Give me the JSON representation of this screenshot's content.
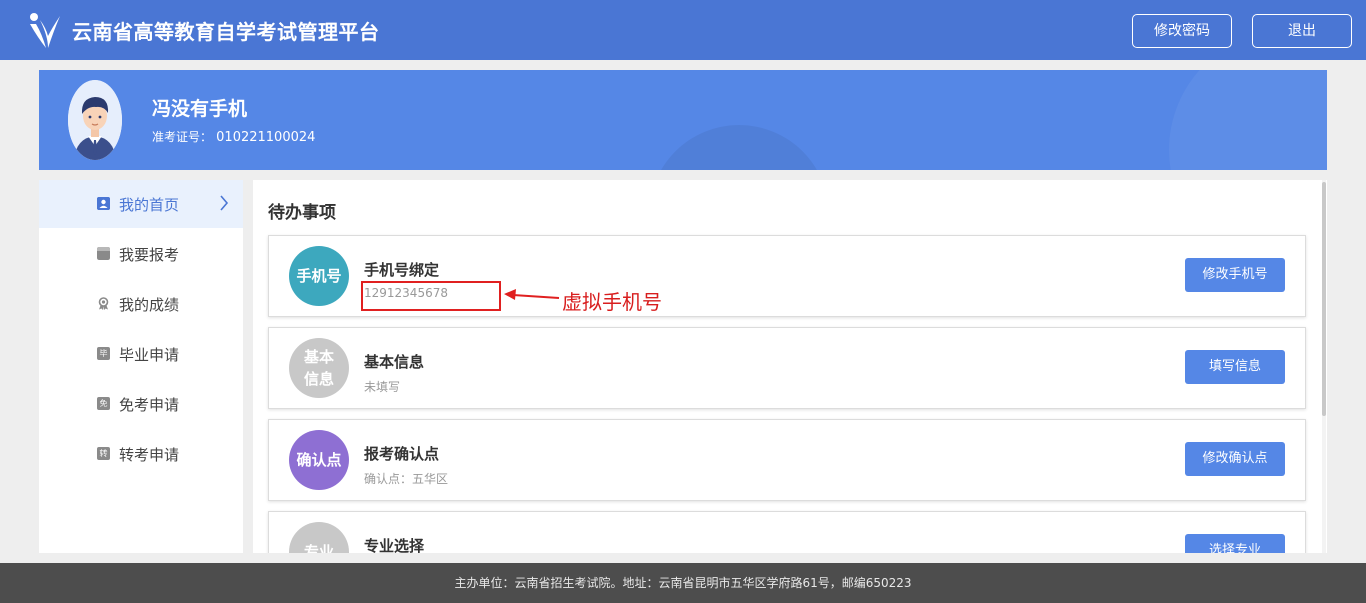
{
  "header": {
    "site_title": "云南省高等教育自学考试管理平台",
    "logo_icon": "brand-logo-icon",
    "change_password_label": "修改密码",
    "logout_label": "退出"
  },
  "profile": {
    "name": "冯没有手机",
    "admission_label": "准考证号：",
    "admission_number": "010221100024"
  },
  "sidebar": {
    "items": [
      {
        "label": "我的首页",
        "icon": "user-icon",
        "glyph": "",
        "active": true
      },
      {
        "label": "我要报考",
        "icon": "form-icon",
        "glyph": "",
        "active": false
      },
      {
        "label": "我的成绩",
        "icon": "award-icon",
        "glyph": "",
        "active": false
      },
      {
        "label": "毕业申请",
        "icon": "graduation-icon",
        "glyph": "毕",
        "active": false
      },
      {
        "label": "免考申请",
        "icon": "exemption-icon",
        "glyph": "免",
        "active": false
      },
      {
        "label": "转考申请",
        "icon": "transfer-icon",
        "glyph": "转",
        "active": false
      }
    ]
  },
  "main": {
    "title": "待办事项",
    "cards": [
      {
        "badge": "手机号",
        "badge_color": "#3da8be",
        "title": "手机号绑定",
        "subtitle": "12912345678",
        "button": "修改手机号"
      },
      {
        "badge": "基本\n信息",
        "badge_color": "#c8c8c8",
        "title": "基本信息",
        "subtitle": "未填写",
        "button": "填写信息"
      },
      {
        "badge": "确认点",
        "badge_color": "#8e6fd3",
        "title": "报考确认点",
        "subtitle": "确认点：五华区",
        "button": "修改确认点"
      },
      {
        "badge": "专业",
        "badge_color": "#c8c8c8",
        "title": "专业选择",
        "subtitle": "",
        "button": "选择专业"
      }
    ]
  },
  "annotation": {
    "text": "虚拟手机号",
    "color": "#e02020"
  },
  "footer": {
    "text": "主办单位：云南省招生考试院。地址：云南省昆明市五华区学府路61号，邮编650223"
  },
  "colors": {
    "primary": "#4a76d4",
    "banner": "#5587e6",
    "button": "#5587e6"
  }
}
